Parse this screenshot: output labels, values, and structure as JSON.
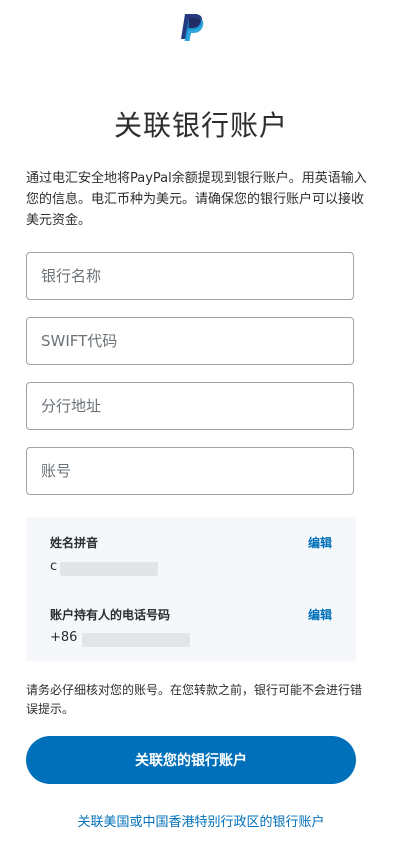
{
  "brand": {
    "logo_icon": "paypal-logo-icon",
    "dark_blue": "#253b80",
    "light_blue": "#179bd7"
  },
  "page": {
    "title": "关联银行账户",
    "description": "通过电汇安全地将PayPal余额提现到银行账户。用英语输入您的信息。电汇币种为美元。请确保您的银行账户可以接收美元资金。"
  },
  "form": {
    "bank_name_placeholder": "银行名称",
    "swift_placeholder": "SWIFT代码",
    "branch_address_placeholder": "分行地址",
    "account_number_placeholder": "账号"
  },
  "info": {
    "name_label": "姓名拼音",
    "name_edit": "编辑",
    "name_value": "c",
    "phone_label": "账户持有人的电话号码",
    "phone_edit": "编辑",
    "phone_value": "+86"
  },
  "notice": "请务必仔细核对您的账号。在您转款之前，银行可能不会进行错误提示。",
  "actions": {
    "link_button": "关联您的银行账户",
    "alt_link": "关联美国或中国香港特别行政区的银行账户"
  },
  "colors": {
    "accent": "#0070ba",
    "panel_bg": "#f5f7fa",
    "border": "#9da3a6"
  }
}
